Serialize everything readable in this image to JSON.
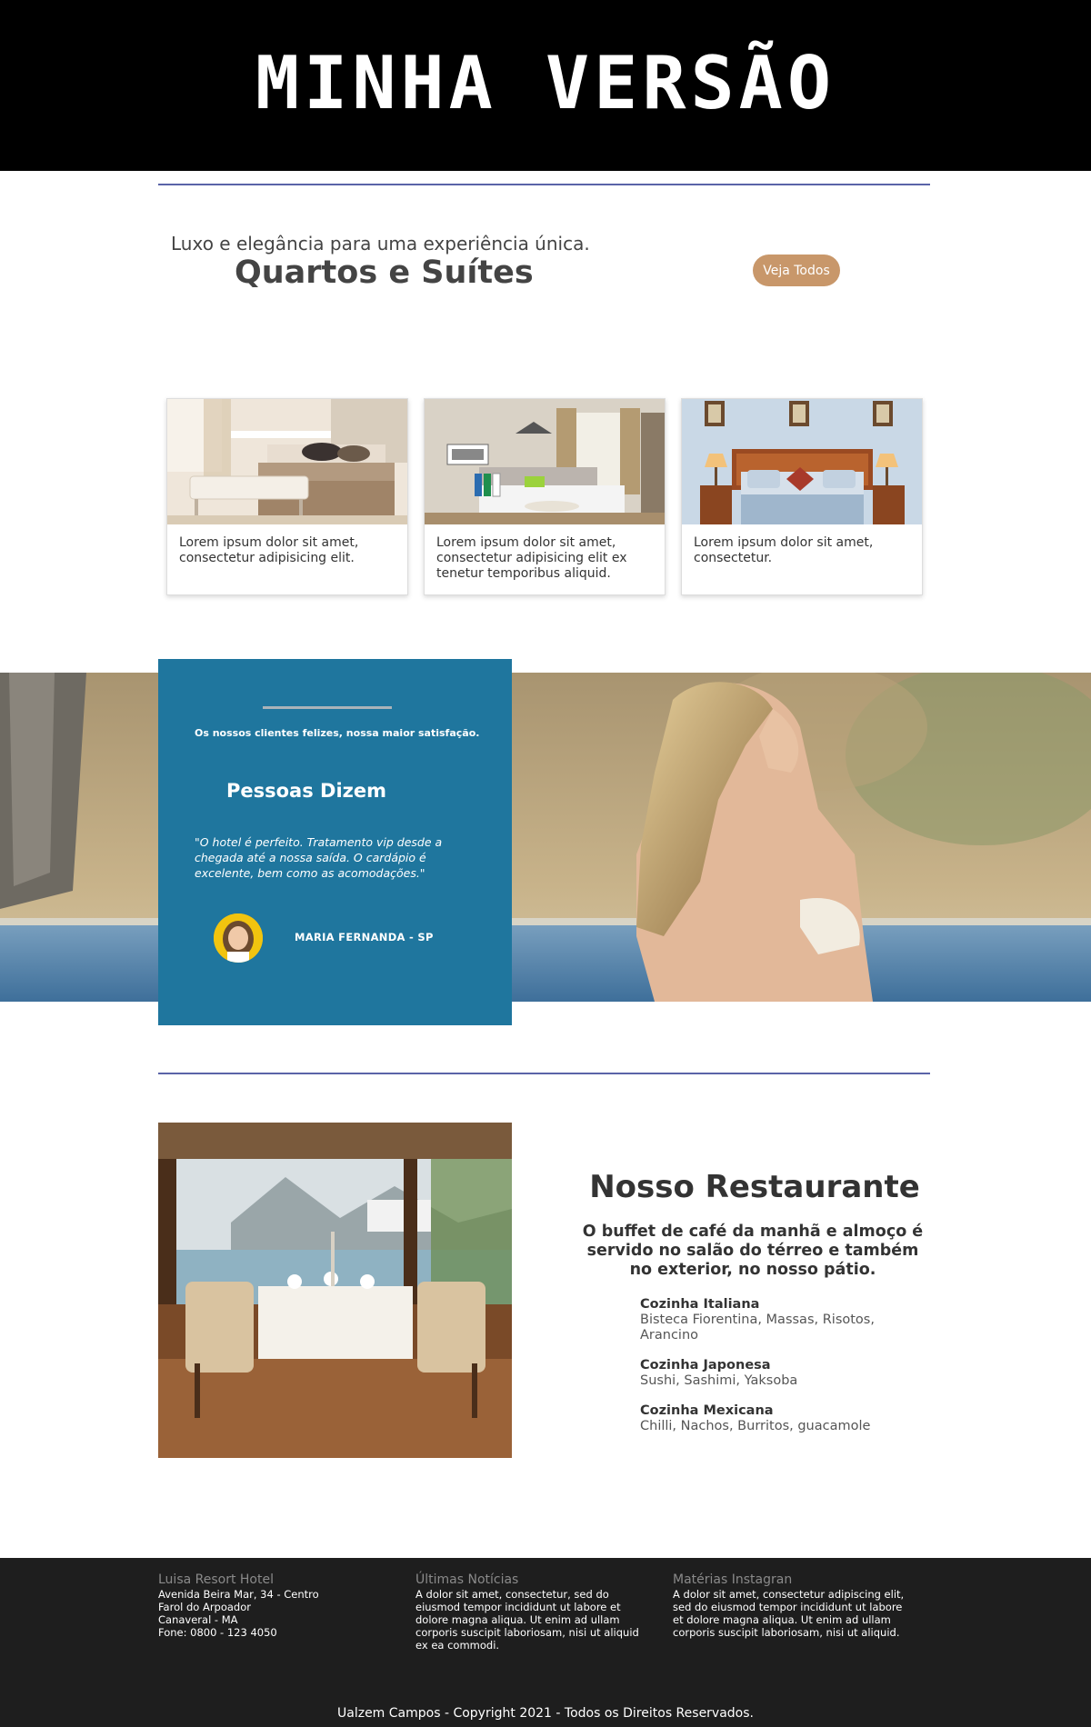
{
  "banner": {
    "title": "MINHA VERSÃO"
  },
  "rooms": {
    "tagline": "Luxo e elegância para uma experiência única.",
    "title": "Quartos e Suítes",
    "view_all_label": "Veja Todos",
    "cards": [
      {
        "text": "Lorem ipsum dolor sit amet, consectetur adipisicing elit."
      },
      {
        "text": "Lorem ipsum dolor sit amet, consectetur adipisicing elit ex tenetur temporibus aliquid."
      },
      {
        "text": "Lorem ipsum dolor sit amet, consectetur."
      }
    ]
  },
  "testimonial": {
    "subtitle": "Os nossos clientes felizes, nossa maior satisfação.",
    "title": "Pessoas Dizem",
    "quote": "\"O hotel é perfeito. Tratamento vip desde a chegada até a nossa saída. O cardápio é excelente, bem como as acomodações.\"",
    "author": "MARIA FERNANDA - SP"
  },
  "restaurant": {
    "title": "Nosso Restaurante",
    "description": "O buffet de café da manhã e almoço é servido no salão do térreo e também no exterior, no nosso pátio.",
    "menus": [
      {
        "name": "Cozinha Italiana",
        "items": "Bisteca Fiorentina, Massas, Risotos, Arancino"
      },
      {
        "name": "Cozinha Japonesa",
        "items": "Sushi, Sashimi, Yaksoba"
      },
      {
        "name": "Cozinha Mexicana",
        "items": "Chilli, Nachos, Burritos, guacamole"
      }
    ]
  },
  "footer": {
    "hotel": {
      "heading": "Luisa Resort Hotel",
      "line1": "Avenida Beira Mar, 34 - Centro",
      "line2": "Farol do Arpoador",
      "line3": "Canaveral - MA",
      "line4": "Fone: 0800 - 123 4050"
    },
    "news": {
      "heading": "Últimas Notícias",
      "text": "A dolor sit amet, consectetur, sed do eiusmod tempor incididunt ut labore et dolore magna aliqua. Ut enim ad ullam corporis suscipit laboriosam, nisi ut aliquid ex ea commodi."
    },
    "instagram": {
      "heading": "Matérias Instagran",
      "text": "A dolor sit amet, consectetur adipiscing elit, sed do eiusmod tempor incididunt ut labore et dolore magna aliqua. Ut enim ad ullam corporis suscipit laboriosam, nisi ut aliquid."
    },
    "copyright": "Ualzem Campos - Copyright 2021 - Todos os Direitos Reservados."
  },
  "colors": {
    "banner_bg": "#000000",
    "accent_button": "#c8976a",
    "testimonial_bg": "#1f769e",
    "divider": "#5a64a8",
    "footer_bg": "#1e1e1e"
  }
}
